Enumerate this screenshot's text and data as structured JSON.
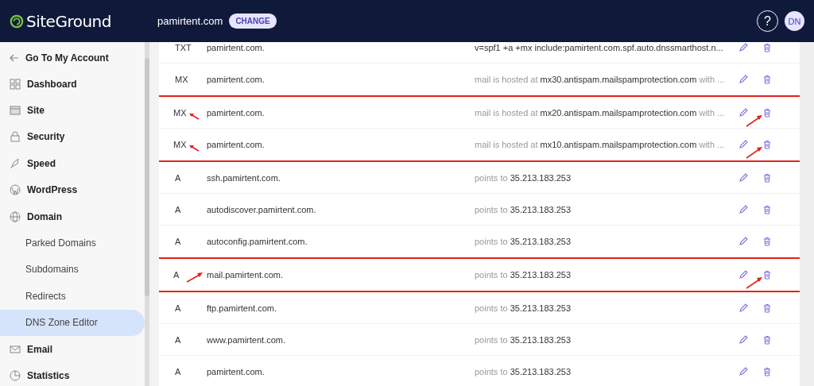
{
  "header": {
    "logo": "SiteGround",
    "site": "pamirtent.com",
    "change_button": "CHANGE",
    "help": "?",
    "avatar": "DN"
  },
  "sidebar": {
    "back": "Go To My Account",
    "items": [
      {
        "label": "Dashboard",
        "kind": "main",
        "selected": false
      },
      {
        "label": "Site",
        "kind": "main",
        "selected": false
      },
      {
        "label": "Security",
        "kind": "main",
        "selected": false
      },
      {
        "label": "Speed",
        "kind": "main",
        "selected": false
      },
      {
        "label": "WordPress",
        "kind": "main",
        "selected": false
      },
      {
        "label": "Domain",
        "kind": "main",
        "selected": false
      },
      {
        "label": "Parked Domains",
        "kind": "sub",
        "selected": false
      },
      {
        "label": "Subdomains",
        "kind": "sub",
        "selected": false
      },
      {
        "label": "Redirects",
        "kind": "sub",
        "selected": false
      },
      {
        "label": "DNS Zone Editor",
        "kind": "sub",
        "selected": true
      },
      {
        "label": "Email",
        "kind": "main",
        "selected": false
      },
      {
        "label": "Statistics",
        "kind": "main",
        "selected": false
      }
    ]
  },
  "records": [
    {
      "type": "TXT",
      "name": "pamirtent.com.",
      "value": {
        "main": "v=spf1 +a +mx include:pamirtent.com.spf.auto.dnssmarthost.n..."
      },
      "highlight": false,
      "arrow_at_type": false,
      "arrow_at_name": false,
      "arrow_at_delete": false
    },
    {
      "type": "MX",
      "name": "pamirtent.com.",
      "value": {
        "prefix": "mail is hosted at",
        "main": "mx30.antispam.mailspamprotection.com",
        "suffix": "with ..."
      },
      "highlight": false,
      "arrow_at_type": false,
      "arrow_at_name": false,
      "arrow_at_delete": false
    },
    {
      "type": "MX",
      "name": "pamirtent.com.",
      "value": {
        "prefix": "mail is hosted at",
        "main": "mx20.antispam.mailspamprotection.com",
        "suffix": "with ..."
      },
      "highlight": true,
      "arrow_at_type": true,
      "arrow_at_name": false,
      "arrow_at_delete": true
    },
    {
      "type": "MX",
      "name": "pamirtent.com.",
      "value": {
        "prefix": "mail is hosted at",
        "main": "mx10.antispam.mailspamprotection.com",
        "suffix": "with ..."
      },
      "highlight": true,
      "arrow_at_type": true,
      "arrow_at_name": false,
      "arrow_at_delete": true
    },
    {
      "type": "A",
      "name": "ssh.pamirtent.com.",
      "value": {
        "prefix": "points to",
        "main": "35.213.183.253"
      },
      "highlight": false,
      "arrow_at_type": false,
      "arrow_at_name": false,
      "arrow_at_delete": false
    },
    {
      "type": "A",
      "name": "autodiscover.pamirtent.com.",
      "value": {
        "prefix": "points to",
        "main": "35.213.183.253"
      },
      "highlight": false,
      "arrow_at_type": false,
      "arrow_at_name": false,
      "arrow_at_delete": false
    },
    {
      "type": "A",
      "name": "autoconfig.pamirtent.com.",
      "value": {
        "prefix": "points to",
        "main": "35.213.183.253"
      },
      "highlight": false,
      "arrow_at_type": false,
      "arrow_at_name": false,
      "arrow_at_delete": false
    },
    {
      "type": "A",
      "name": "mail.pamirtent.com.",
      "value": {
        "prefix": "points to",
        "main": "35.213.183.253"
      },
      "highlight": true,
      "arrow_at_type": false,
      "arrow_at_name": true,
      "arrow_at_delete": true
    },
    {
      "type": "A",
      "name": "ftp.pamirtent.com.",
      "value": {
        "prefix": "points to",
        "main": "35.213.183.253"
      },
      "highlight": false,
      "arrow_at_type": false,
      "arrow_at_name": false,
      "arrow_at_delete": false
    },
    {
      "type": "A",
      "name": "www.pamirtent.com.",
      "value": {
        "prefix": "points to",
        "main": "35.213.183.253"
      },
      "highlight": false,
      "arrow_at_type": false,
      "arrow_at_name": false,
      "arrow_at_delete": false
    },
    {
      "type": "A",
      "name": "pamirtent.com.",
      "value": {
        "prefix": "points to",
        "main": "35.213.183.253"
      },
      "highlight": false,
      "arrow_at_type": false,
      "arrow_at_name": false,
      "arrow_at_delete": false
    }
  ]
}
